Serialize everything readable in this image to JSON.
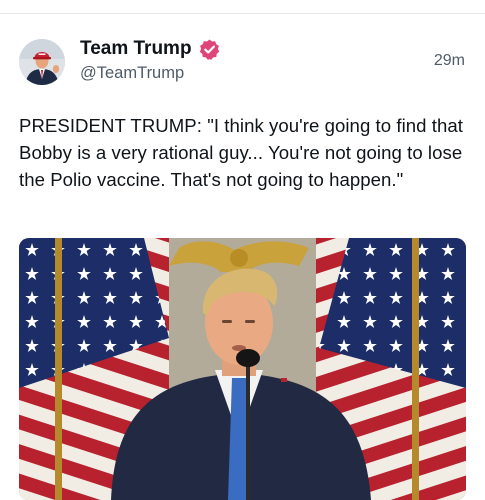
{
  "post": {
    "author": {
      "display_name": "Team Trump",
      "handle": "@TeamTrump",
      "verified": true,
      "badge_icon": "verified-badge-icon",
      "badge_color": "#e0457a"
    },
    "timestamp": "29m",
    "text": "PRESIDENT TRUMP: \"I think you're going to find that Bobby is a very rational guy... You're not going to lose the Polio vaccine. That's not going to happen.\""
  },
  "colors": {
    "divider": "#e6e8eb",
    "secondary_text": "#4f5b66"
  }
}
